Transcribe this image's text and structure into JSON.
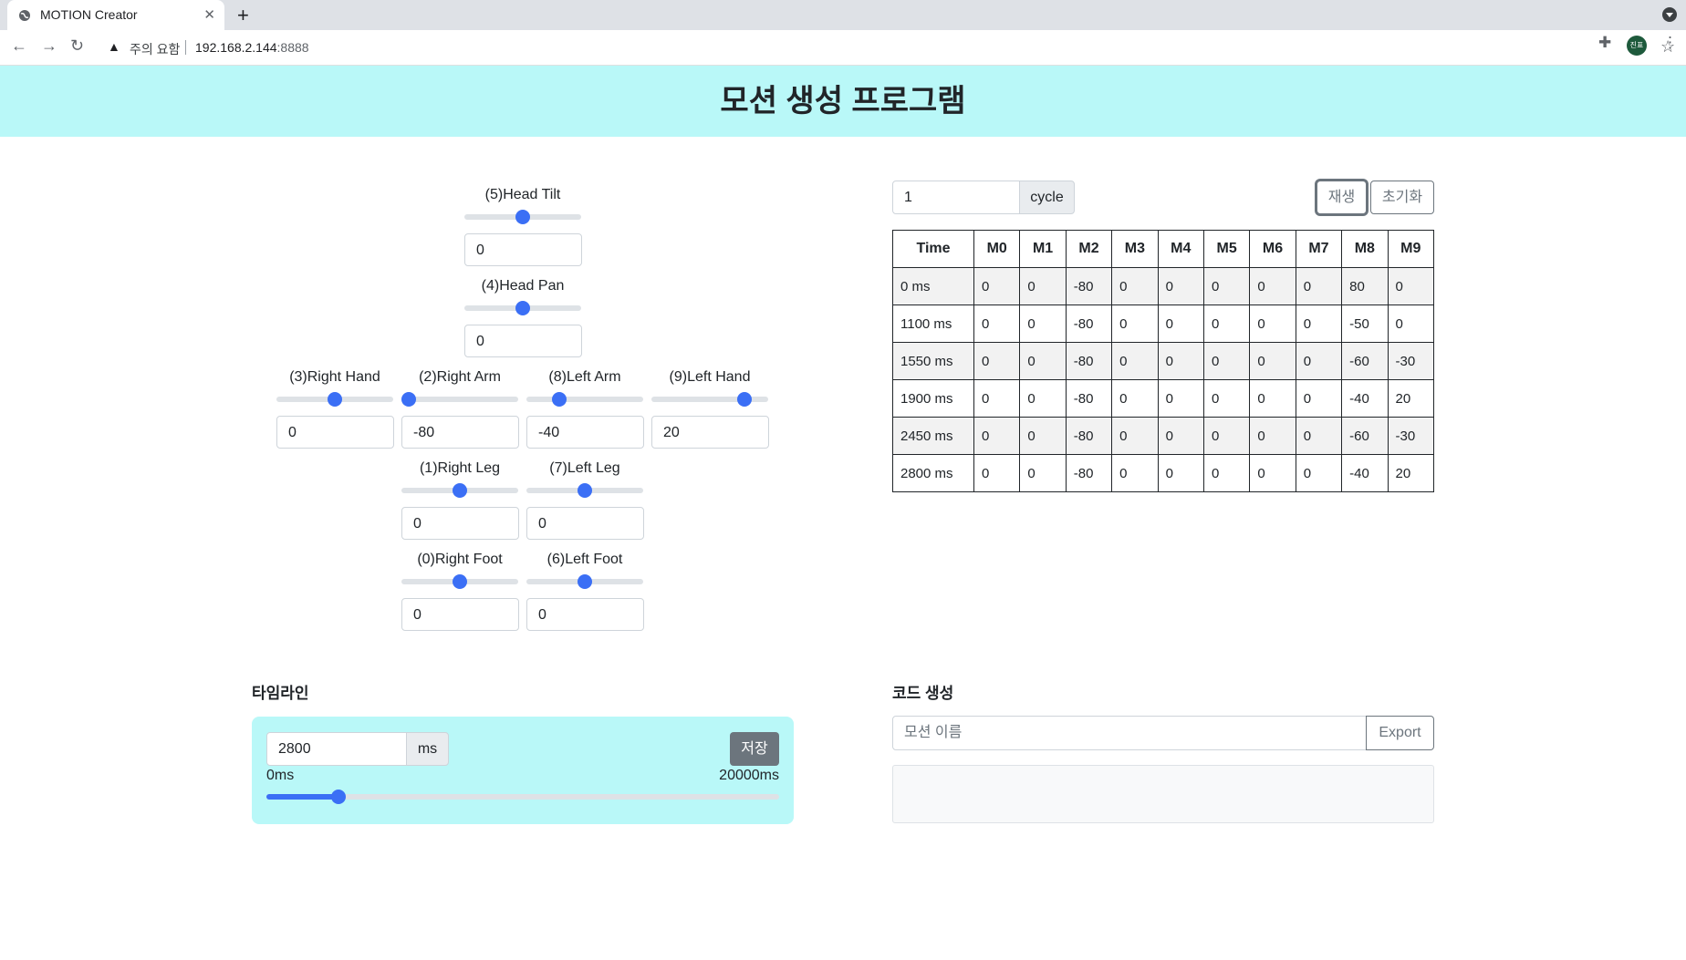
{
  "browser": {
    "tab_title": "MOTION Creator",
    "tab_close": "✕",
    "new_tab": "+",
    "nav": {
      "back": "←",
      "forward": "→",
      "reload": "↻"
    },
    "security_warning": "주의 요함",
    "url_host": "192.168.2.144",
    "url_port": ":8888",
    "profile_initials": "진표"
  },
  "page": {
    "title": "모션 생성 프로그램",
    "accent_color": "#3b6ff5",
    "banner_color": "#b9f8f8"
  },
  "sliders": {
    "head_tilt": {
      "label": "(5)Head Tilt",
      "value": "0",
      "fraction": 0.5
    },
    "head_pan": {
      "label": "(4)Head Pan",
      "value": "0",
      "fraction": 0.5
    },
    "right_hand": {
      "label": "(3)Right Hand",
      "value": "0",
      "fraction": 0.5
    },
    "right_arm": {
      "label": "(2)Right Arm",
      "value": "-80",
      "fraction": 0.06
    },
    "left_arm": {
      "label": "(8)Left Arm",
      "value": "-40",
      "fraction": 0.28
    },
    "left_hand": {
      "label": "(9)Left Hand",
      "value": "20",
      "fraction": 0.8
    },
    "right_leg": {
      "label": "(1)Right Leg",
      "value": "0",
      "fraction": 0.5
    },
    "left_leg": {
      "label": "(7)Left Leg",
      "value": "0",
      "fraction": 0.5
    },
    "right_foot": {
      "label": "(0)Right Foot",
      "value": "0",
      "fraction": 0.5
    },
    "left_foot": {
      "label": "(6)Left Foot",
      "value": "0",
      "fraction": 0.5
    }
  },
  "playback": {
    "cycle_value": "1",
    "cycle_unit": "cycle",
    "play_label": "재생",
    "reset_label": "초기화"
  },
  "table": {
    "headers": [
      "Time",
      "M0",
      "M1",
      "M2",
      "M3",
      "M4",
      "M5",
      "M6",
      "M7",
      "M8",
      "M9"
    ],
    "rows": [
      [
        "0 ms",
        "0",
        "0",
        "-80",
        "0",
        "0",
        "0",
        "0",
        "0",
        "80",
        "0"
      ],
      [
        "1100 ms",
        "0",
        "0",
        "-80",
        "0",
        "0",
        "0",
        "0",
        "0",
        "-50",
        "0"
      ],
      [
        "1550 ms",
        "0",
        "0",
        "-80",
        "0",
        "0",
        "0",
        "0",
        "0",
        "-60",
        "-30"
      ],
      [
        "1900 ms",
        "0",
        "0",
        "-80",
        "0",
        "0",
        "0",
        "0",
        "0",
        "-40",
        "20"
      ],
      [
        "2450 ms",
        "0",
        "0",
        "-80",
        "0",
        "0",
        "0",
        "0",
        "0",
        "-60",
        "-30"
      ],
      [
        "2800 ms",
        "0",
        "0",
        "-80",
        "0",
        "0",
        "0",
        "0",
        "0",
        "-40",
        "20"
      ]
    ]
  },
  "timeline": {
    "title": "타임라인",
    "value": "2800",
    "unit": "ms",
    "save_label": "저장",
    "min_label": "0ms",
    "max_label": "20000ms",
    "fraction": 0.14
  },
  "codegen": {
    "title": "코드 생성",
    "name_placeholder": "모션 이름",
    "export_label": "Export",
    "code": ""
  }
}
